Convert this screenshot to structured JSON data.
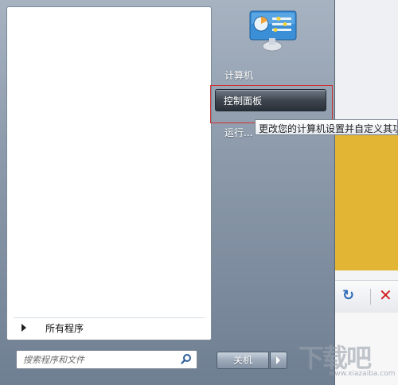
{
  "start_menu": {
    "all_programs_label": "所有程序",
    "search": {
      "placeholder": "搜索程序和文件"
    },
    "right_items": {
      "computer": "计算机",
      "control_panel": "控制面板",
      "run": "运行..."
    },
    "tooltip": "更改您的计算机设置并自定义其功能",
    "shutdown_label": "关机"
  },
  "background_window": {
    "toolbar_icons": [
      "refresh-icon",
      "close-icon"
    ]
  },
  "watermark": {
    "big": "下载吧",
    "url": "www.xiazaiba.com"
  },
  "colors": {
    "highlight_border": "#d03030",
    "yellow_panel": "#e2b535"
  }
}
